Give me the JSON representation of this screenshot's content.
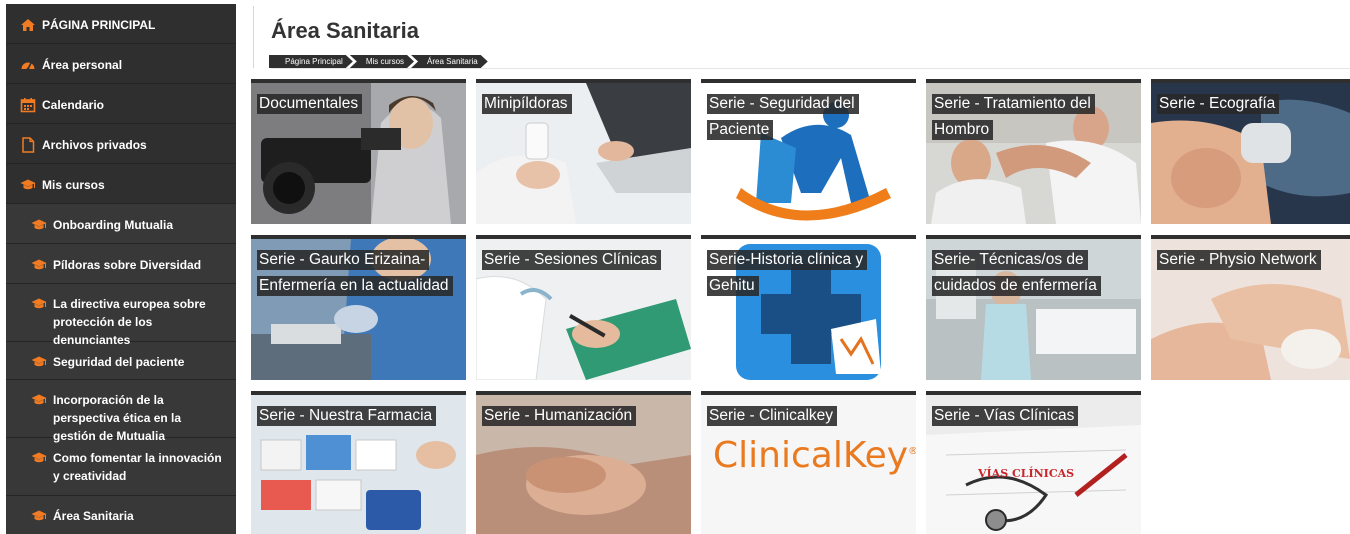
{
  "sidebar": {
    "items": [
      {
        "label": "PÁGINA PRINCIPAL",
        "icon": "home-icon"
      },
      {
        "label": "Área personal",
        "icon": "dashboard-icon"
      },
      {
        "label": "Calendario",
        "icon": "calendar-icon"
      },
      {
        "label": "Archivos privados",
        "icon": "file-icon"
      },
      {
        "label": "Mis cursos",
        "icon": "graduation-cap-icon"
      },
      {
        "label": "Onboarding Mutualia",
        "icon": "graduation-cap-icon"
      },
      {
        "label": "Píldoras sobre Diversidad",
        "icon": "graduation-cap-icon"
      },
      {
        "label": "La directiva europea sobre protección de los denunciantes",
        "icon": "graduation-cap-icon"
      },
      {
        "label": "Seguridad del paciente",
        "icon": "graduation-cap-icon"
      },
      {
        "label": "Incorporación de la perspectiva ética en la gestión de Mutualia",
        "icon": "graduation-cap-icon"
      },
      {
        "label": "Como fomentar la innovación y creatividad",
        "icon": "graduation-cap-icon"
      },
      {
        "label": "Área Sanitaria",
        "icon": "graduation-cap-icon"
      }
    ]
  },
  "header": {
    "title": "Área Sanitaria",
    "breadcrumb": [
      "Página Principal",
      "Mis cursos",
      "Área Sanitaria"
    ]
  },
  "courses": [
    {
      "title": "Documentales",
      "image": "camera-operator-photo"
    },
    {
      "title": "Minipíldoras",
      "image": "pills-laptop-photo"
    },
    {
      "title": "Serie - Seguridad del Paciente",
      "image": "patient-safety-logo"
    },
    {
      "title": "Serie - Tratamiento del Hombro",
      "image": "shoulder-therapy-photo"
    },
    {
      "title": "Serie - Ecografía",
      "image": "ultrasound-photo"
    },
    {
      "title": "Serie - Gaurko Erizaina-Enfermería en la actualidad",
      "image": "nurse-photo"
    },
    {
      "title": "Serie - Sesiones Clínicas",
      "image": "clinical-notes-photo"
    },
    {
      "title": "Serie-Historia clínica y Gehitu",
      "image": "medical-cross-icon"
    },
    {
      "title": "Serie- Técnicas/os de cuidados de enfermería",
      "image": "hospital-ward-photo"
    },
    {
      "title": "Serie - Physio Network",
      "image": "hand-massage-photo"
    },
    {
      "title": "Serie - Nuestra Farmacia",
      "image": "pharmacy-shelf-photo"
    },
    {
      "title": "Serie - Humanización",
      "image": "holding-hands-photo"
    },
    {
      "title": "Serie - Clinicalkey",
      "image": "clinicalkey-logo",
      "logo_text": "ClinicalKey",
      "logo_mark": "®"
    },
    {
      "title": "Serie - Vías Clínicas",
      "image": "stethoscope-document-photo",
      "doc_text": "VÍAS CLÍNICAS"
    }
  ],
  "colors": {
    "sidebar_bg": "#2f2f2f",
    "accent": "#f07b22",
    "caption_bg": "#282828"
  }
}
